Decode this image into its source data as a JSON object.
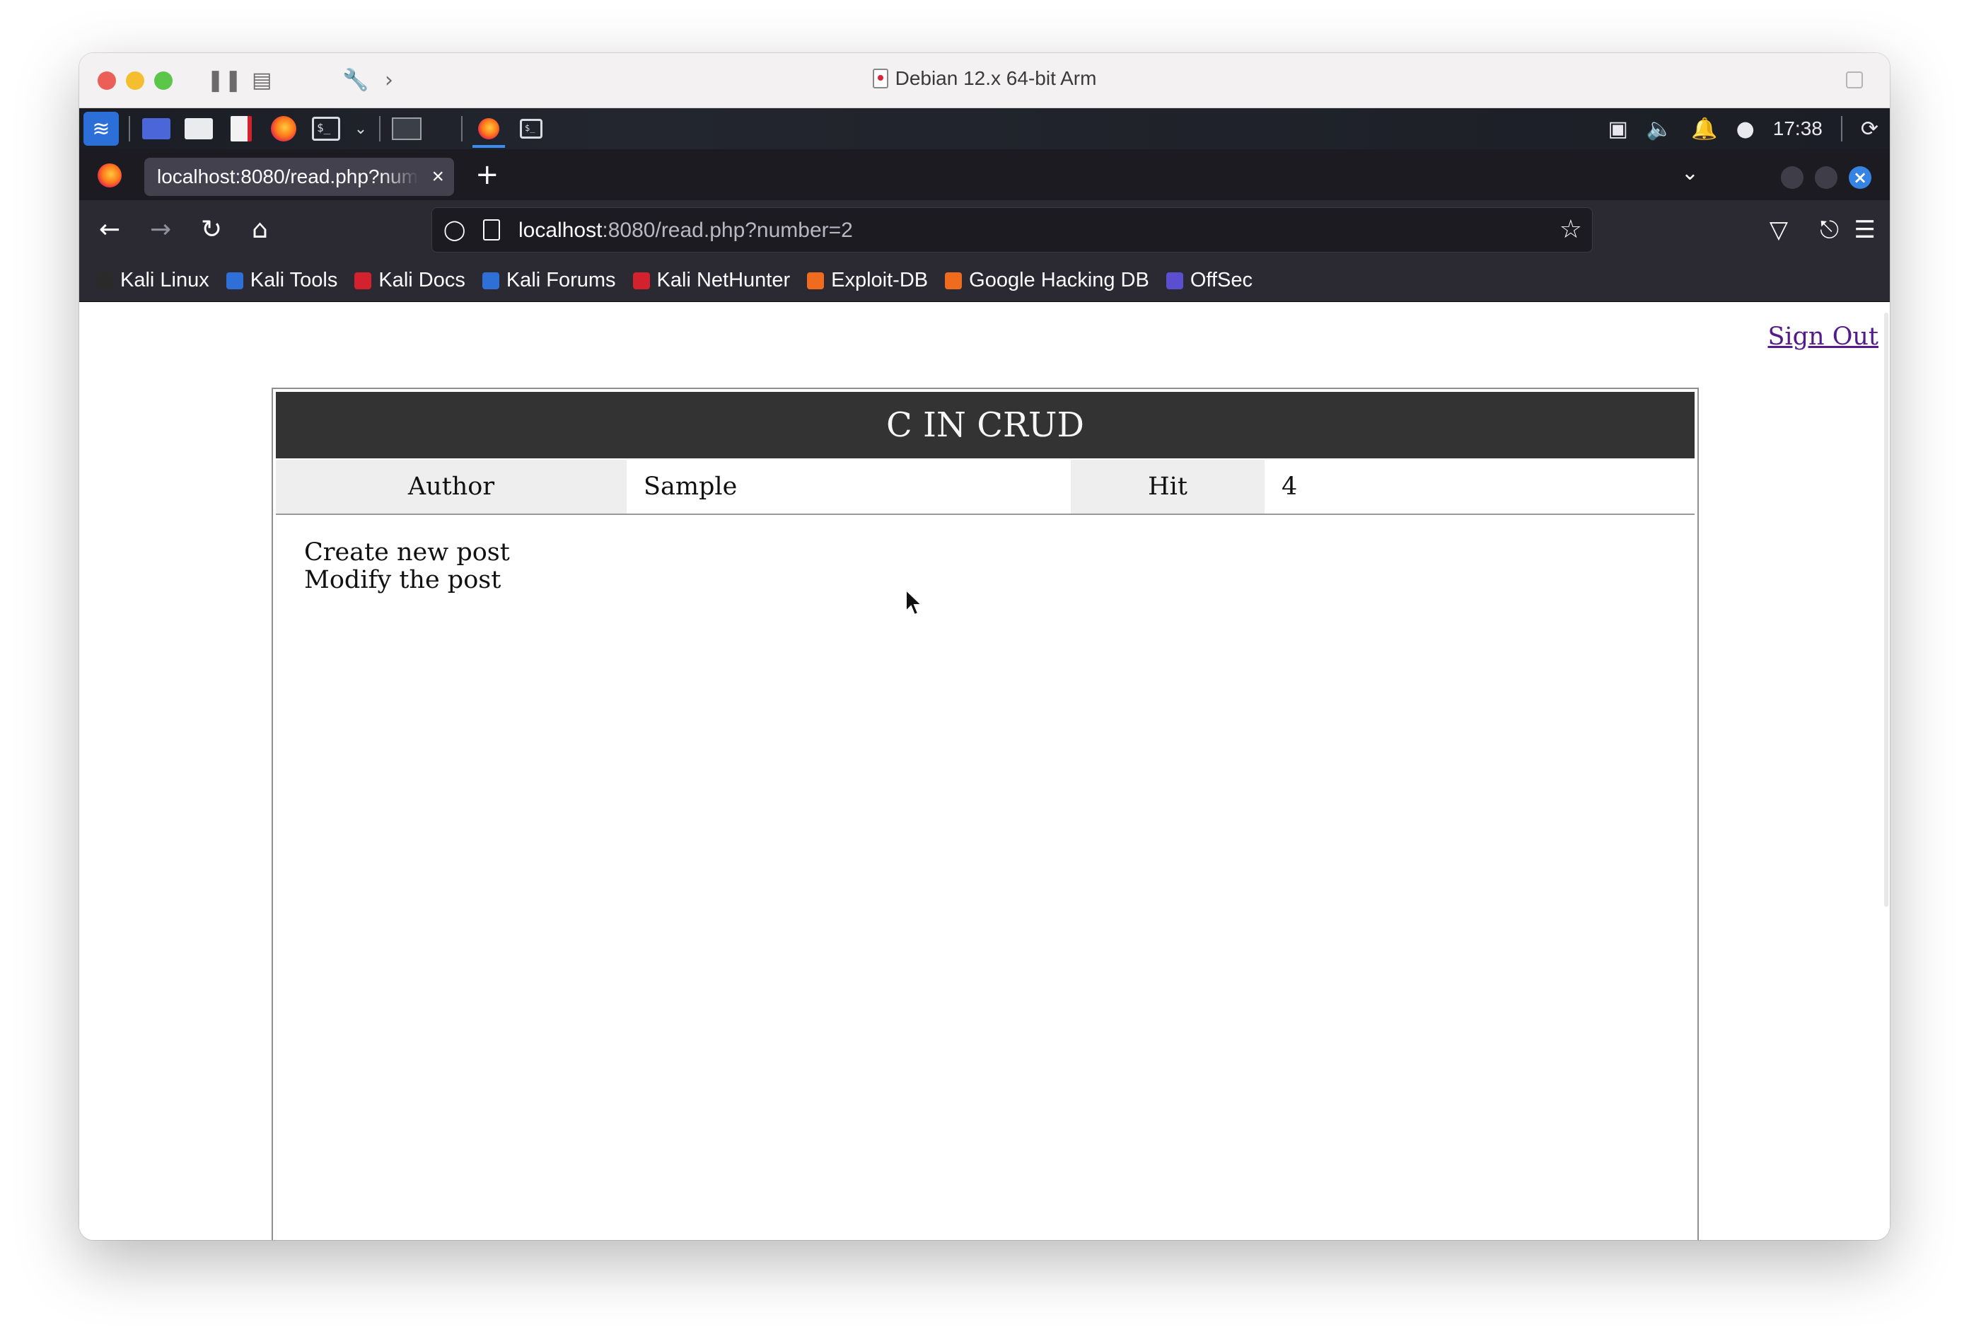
{
  "vm": {
    "title": "Debian 12.x 64-bit Arm"
  },
  "panel": {
    "clock": "17:38"
  },
  "browser": {
    "tab": {
      "label": "localhost:8080/read.php?number=2"
    },
    "url": {
      "host": "localhost",
      "rest": ":8080/read.php?number=2"
    },
    "bookmarks": [
      {
        "label": "Kali Linux",
        "color": "#2a2a2a"
      },
      {
        "label": "Kali Tools",
        "color": "#2f6fd8"
      },
      {
        "label": "Kali Docs",
        "color": "#d3212d"
      },
      {
        "label": "Kali Forums",
        "color": "#2f6fd8"
      },
      {
        "label": "Kali NetHunter",
        "color": "#d3212d"
      },
      {
        "label": "Exploit-DB",
        "color": "#ef6b1e"
      },
      {
        "label": "Google Hacking DB",
        "color": "#ef6b1e"
      },
      {
        "label": "OffSec",
        "color": "#5a4fcf"
      }
    ]
  },
  "page": {
    "sign_out": "Sign Out",
    "board_title": "C IN CRUD",
    "author_label": "Author",
    "author_value": "Sample",
    "hit_label": "Hit",
    "hit_value": "4",
    "content": [
      "Create new post",
      "Modify the post"
    ]
  }
}
